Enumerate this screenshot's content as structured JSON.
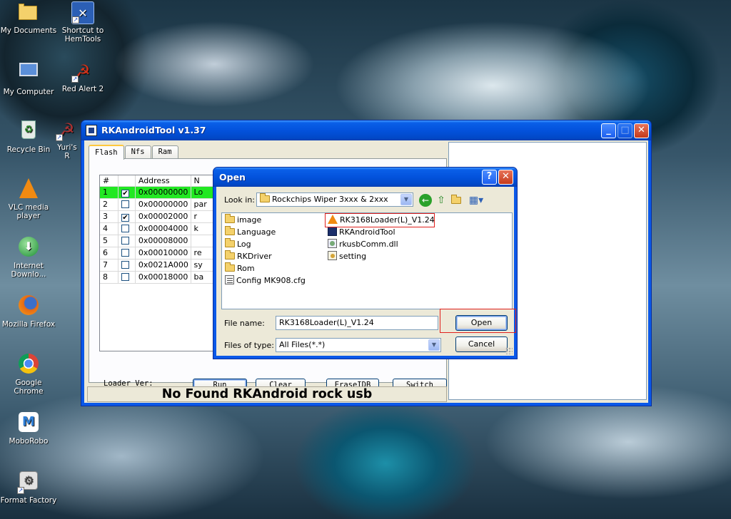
{
  "desktop": {
    "icons": [
      {
        "label": "My Documents",
        "icon": "my-documents-icon",
        "shortcut": false
      },
      {
        "label": "Shortcut to HemTools",
        "icon": "hemtools-icon",
        "shortcut": true
      },
      {
        "label": "My Computer",
        "icon": "my-computer-icon",
        "shortcut": false
      },
      {
        "label": "Red Alert 2",
        "icon": "red-alert-icon",
        "shortcut": true
      },
      {
        "label": "Recycle Bin",
        "icon": "recycle-bin-icon",
        "shortcut": false
      },
      {
        "label": "Yuri's R",
        "icon": "yuris-revenge-icon",
        "shortcut": true
      },
      {
        "label": "VLC media player",
        "icon": "vlc-icon",
        "shortcut": false
      },
      {
        "label": "Internet Downlo...",
        "icon": "internet-download-icon",
        "shortcut": false
      },
      {
        "label": "Mozilla Firefox",
        "icon": "firefox-icon",
        "shortcut": false
      },
      {
        "label": "Google Chrome",
        "icon": "chrome-icon",
        "shortcut": false
      },
      {
        "label": "MoboRobo",
        "icon": "moborobo-icon",
        "shortcut": false
      },
      {
        "label": "Format Factory",
        "icon": "format-factory-icon",
        "shortcut": false
      }
    ]
  },
  "main_window": {
    "title": "RKAndroidTool v1.37",
    "tabs": [
      {
        "label": "Flash",
        "active": true
      },
      {
        "label": "Nfs",
        "active": false
      },
      {
        "label": "Ram",
        "active": false
      }
    ],
    "grid": {
      "headers": [
        "#",
        "",
        "Address",
        "N"
      ],
      "rows": [
        {
          "num": "1",
          "checked": true,
          "address": "0x00000000",
          "name": "Lo",
          "selected": true
        },
        {
          "num": "2",
          "checked": false,
          "address": "0x00000000",
          "name": "par",
          "selected": false
        },
        {
          "num": "3",
          "checked": true,
          "address": "0x00002000",
          "name": "r",
          "selected": false
        },
        {
          "num": "4",
          "checked": false,
          "address": "0x00004000",
          "name": "k",
          "selected": false
        },
        {
          "num": "5",
          "checked": false,
          "address": "0x00008000",
          "name": "",
          "selected": false
        },
        {
          "num": "6",
          "checked": false,
          "address": "0x00010000",
          "name": "re",
          "selected": false
        },
        {
          "num": "7",
          "checked": false,
          "address": "0x0021A000",
          "name": "sy",
          "selected": false
        },
        {
          "num": "8",
          "checked": false,
          "address": "0x00018000",
          "name": "ba",
          "selected": false
        }
      ]
    },
    "loader_ver_label": "Loader Ver:",
    "buttons": {
      "run": "Run",
      "clear": "Clear",
      "erase_idb": "EraseIDB",
      "switch": "Switch"
    },
    "status": "No Found RKAndroid rock usb",
    "check_mark": "✔",
    "window_buttons": {
      "minimize": "_",
      "maximize": "□",
      "close": "✕"
    }
  },
  "open_dialog": {
    "title": "Open",
    "help": "?",
    "close": "✕",
    "look_in_label": "Look in:",
    "look_in_value": "Rockchips Wiper 3xxx & 2xxx",
    "files_left": [
      {
        "name": "image",
        "type": "folder"
      },
      {
        "name": "Language",
        "type": "folder"
      },
      {
        "name": "Log",
        "type": "folder"
      },
      {
        "name": "RKDriver",
        "type": "folder"
      },
      {
        "name": "Rom",
        "type": "folder"
      },
      {
        "name": "Config MK908.cfg",
        "type": "cfg"
      }
    ],
    "files_right": [
      {
        "name": "RK3168Loader(L)_V1.24",
        "type": "vlc",
        "highlighted": true
      },
      {
        "name": "RKAndroidTool",
        "type": "app",
        "highlighted": false
      },
      {
        "name": "rkusbComm.dll",
        "type": "dll",
        "highlighted": false
      },
      {
        "name": "setting",
        "type": "ini",
        "highlighted": false
      }
    ],
    "file_name_label": "File name:",
    "file_name_value": "RK3168Loader(L)_V1.24",
    "files_of_type_label": "Files of type:",
    "files_of_type_value": "All Files(*.*)",
    "open_button": "Open",
    "cancel_button": "Cancel",
    "colors": {
      "highlight_box": "#e0201c",
      "selected_row": "#22e822",
      "title_blue": "#0352dc"
    }
  }
}
